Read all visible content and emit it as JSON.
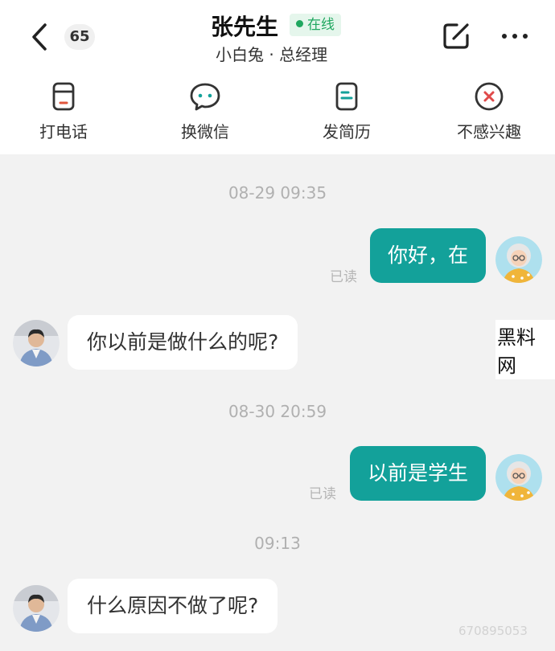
{
  "header": {
    "unread_count": "65",
    "contact_name": "张先生",
    "online_status": "在线",
    "contact_subtitle": "小白兔 · 总经理"
  },
  "actions": [
    {
      "label": "打电话",
      "icon": "phone-icon"
    },
    {
      "label": "换微信",
      "icon": "wechat-icon"
    },
    {
      "label": "发简历",
      "icon": "resume-icon"
    },
    {
      "label": "不感兴趣",
      "icon": "not-interested-icon"
    }
  ],
  "chat": {
    "timestamps": [
      "08-29 09:35",
      "08-30 20:59",
      "09:13"
    ],
    "messages": [
      {
        "direction": "out",
        "text": "你好，在",
        "status": "已读"
      },
      {
        "direction": "in",
        "text": "你以前是做什么的呢?"
      },
      {
        "direction": "out",
        "text": "以前是学生",
        "status": "已读"
      },
      {
        "direction": "in",
        "text": "什么原因不做了呢?"
      }
    ]
  },
  "watermark": {
    "site": "黑料网",
    "id_text": "670895053"
  },
  "colors": {
    "accent": "#13a19a",
    "online_green": "#20a760",
    "not_interested_red": "#e04a4a",
    "background": "#f2f2f2"
  }
}
